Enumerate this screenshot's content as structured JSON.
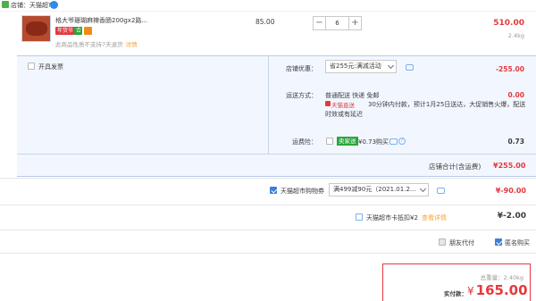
{
  "shop": {
    "label": "店铺：天猫超市"
  },
  "item": {
    "title": "格大爷珊瑚麻辣香肠200gx2路...",
    "badge": "年货节",
    "badge_g": "合",
    "note": "此商品性质不支持7天退货",
    "note_link": "详情",
    "unit_price": "85.00",
    "qty_minus": "−",
    "quantity": "6",
    "qty_plus": "+",
    "line_total": "510.00",
    "line_weight": "2.4kg"
  },
  "invoice": {
    "label": "开具发票"
  },
  "coupon": {
    "label": "店铺优惠：",
    "selected": "省255元:满减活动",
    "amount": "-255.00"
  },
  "shipping": {
    "label": "运送方式：",
    "method": "普通配送 快递 免邮",
    "tmall": "天猫直送",
    "desc1": "30分钟内付款，预计1月25日送达，大促销售火爆，配送",
    "desc2": "时效或有延迟",
    "amount": "0.00"
  },
  "insurance": {
    "label": "运费险：",
    "badge": "卖家送",
    "price": "¥0.73购买",
    "amount": "0.73"
  },
  "shop_total": {
    "label": "店铺合计(含运费)",
    "amount": "¥255.00"
  },
  "voucher": {
    "label": "天猫超市购物券",
    "selected": "满499减90元（2021.01.2...",
    "amount": "¥-90.00"
  },
  "card": {
    "label": "天猫超市卡抵扣¥2",
    "link": "查看详情",
    "amount": "¥-2.00"
  },
  "options": {
    "friend_pay": "朋友代付",
    "anonymous": "匿名购买"
  },
  "summary": {
    "weight": "总重量：2.40kg",
    "pay_label": "实付款：",
    "currency": "¥",
    "pay_amount": "165.00"
  },
  "colors": {
    "accent_red": "#e4393c",
    "link_blue": "#3d7fd9",
    "panel_blue": "#f2f7ff"
  }
}
